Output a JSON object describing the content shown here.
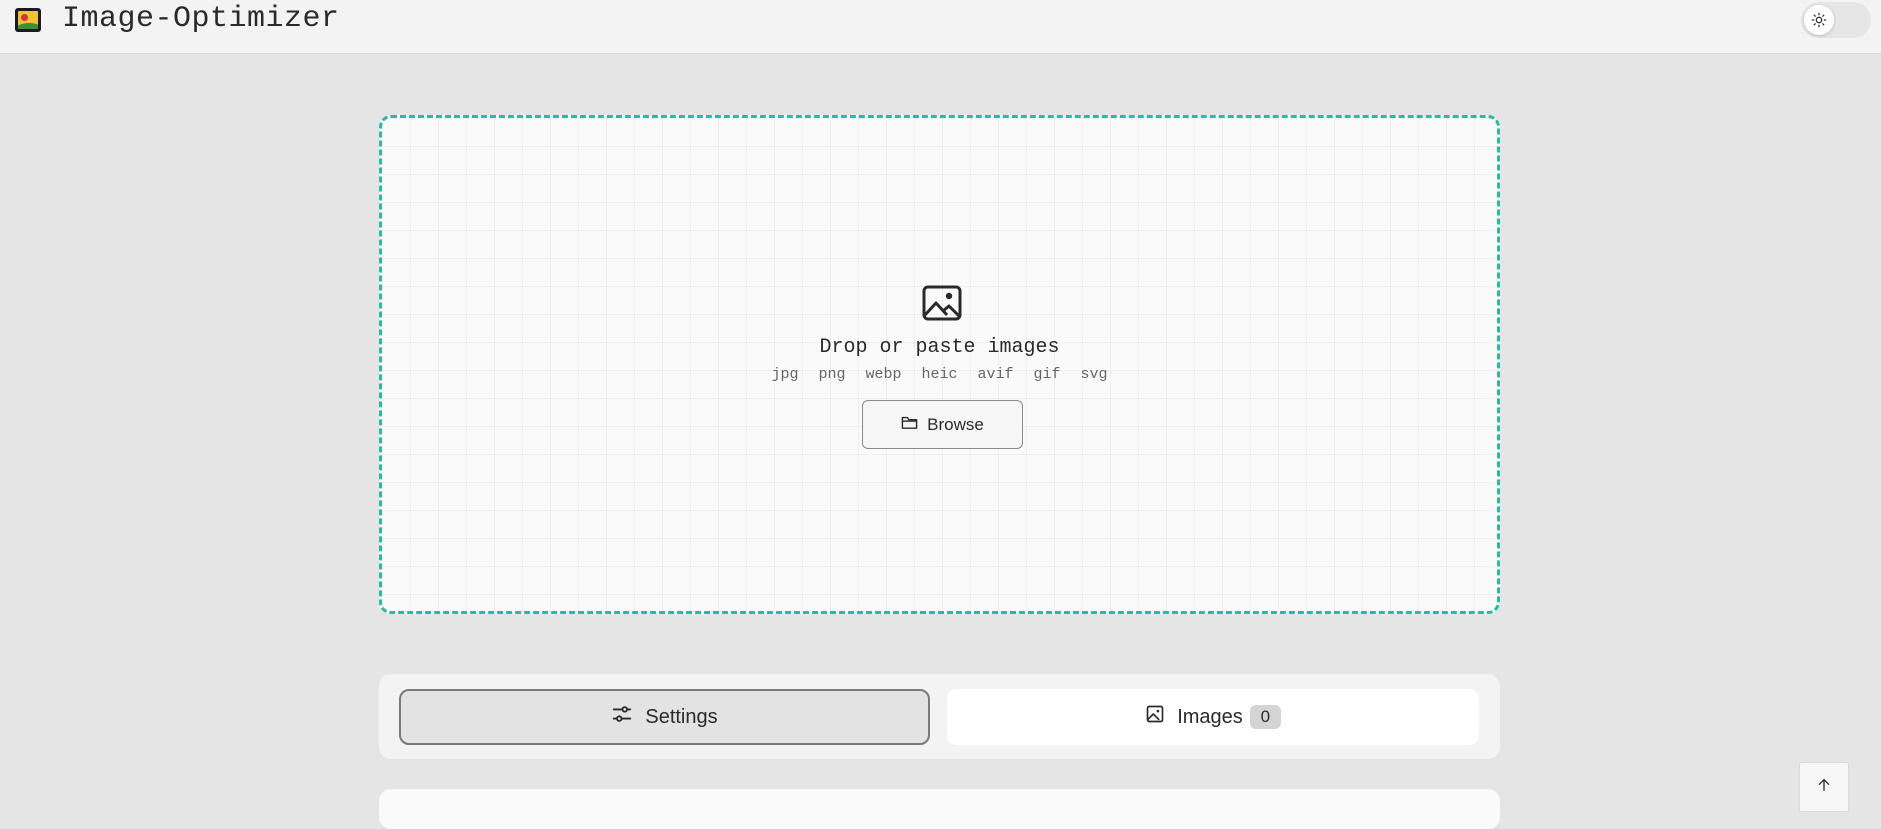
{
  "header": {
    "title": "Image-Optimizer",
    "logo_icon": "image-logo-icon",
    "theme_toggle_icon": "sun-icon"
  },
  "dropzone": {
    "icon": "image-icon",
    "title": "Drop or paste images",
    "formats": [
      "jpg",
      "png",
      "webp",
      "heic",
      "avif",
      "gif",
      "svg"
    ],
    "browse_label": "Browse",
    "browse_icon": "folder-icon",
    "border_color": "#2bb8a6"
  },
  "tabs": {
    "settings_label": "Settings",
    "settings_icon": "sliders-icon",
    "images_label": "Images",
    "images_icon": "image-icon",
    "images_count": "0"
  },
  "scroll_top_icon": "arrow-up-icon"
}
